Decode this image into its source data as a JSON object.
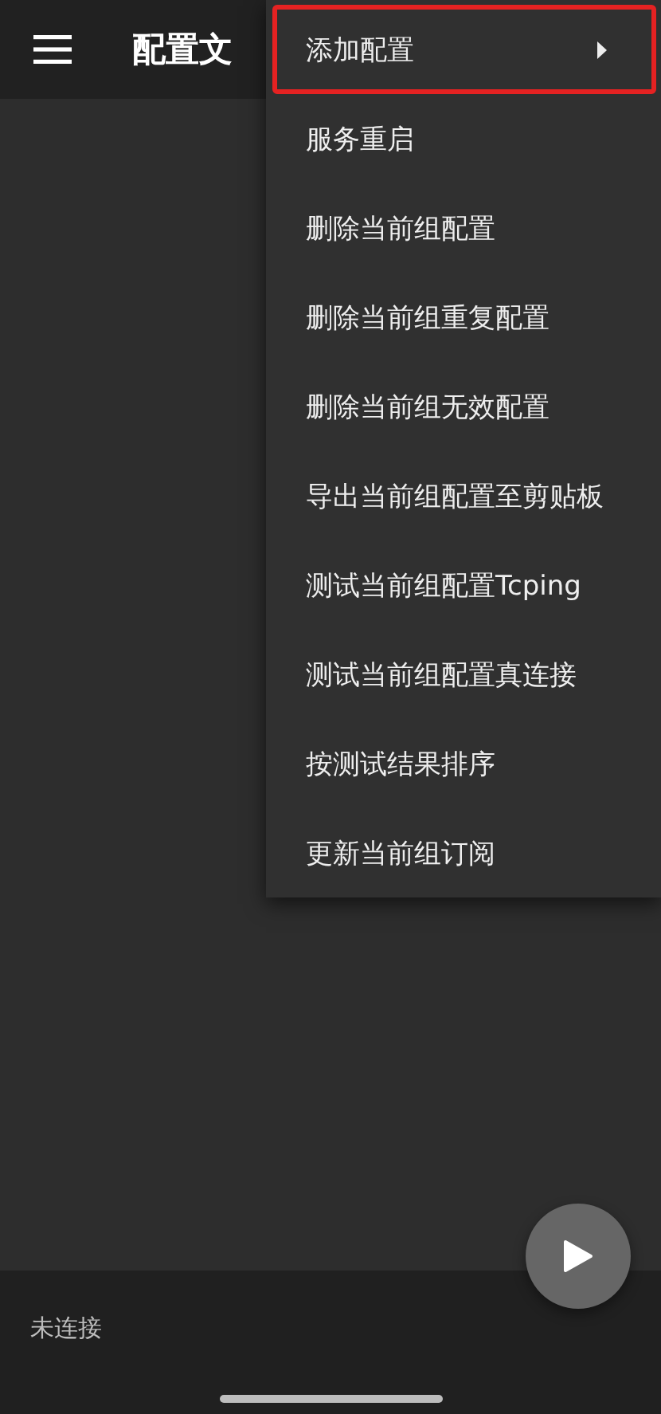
{
  "app_bar": {
    "title": "配置文"
  },
  "menu": {
    "items": [
      {
        "label": "添加配置",
        "has_submenu": true,
        "highlighted": true
      },
      {
        "label": "服务重启",
        "has_submenu": false,
        "highlighted": false
      },
      {
        "label": "删除当前组配置",
        "has_submenu": false,
        "highlighted": false
      },
      {
        "label": "删除当前组重复配置",
        "has_submenu": false,
        "highlighted": false
      },
      {
        "label": "删除当前组无效配置",
        "has_submenu": false,
        "highlighted": false
      },
      {
        "label": "导出当前组配置至剪贴板",
        "has_submenu": false,
        "highlighted": false
      },
      {
        "label": "测试当前组配置Tcping",
        "has_submenu": false,
        "highlighted": false
      },
      {
        "label": "测试当前组配置真连接",
        "has_submenu": false,
        "highlighted": false
      },
      {
        "label": "按测试结果排序",
        "has_submenu": false,
        "highlighted": false
      },
      {
        "label": "更新当前组订阅",
        "has_submenu": false,
        "highlighted": false
      }
    ]
  },
  "status_bar": {
    "text": "未连接"
  }
}
